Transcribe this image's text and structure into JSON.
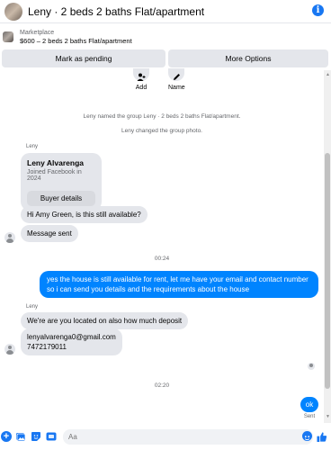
{
  "header": {
    "title": "Leny · 2 beds 2 baths Flat/apartment",
    "info_glyph": "i"
  },
  "marketplace": {
    "label": "Marketplace",
    "listing": "$600 – 2 beds 2 baths Flat/apartment"
  },
  "actions": {
    "mark_pending": "Mark as pending",
    "more_options": "More Options"
  },
  "quick_actions": [
    {
      "label": "Add",
      "icon": "add-person-icon"
    },
    {
      "label": "Name",
      "icon": "pencil-icon"
    }
  ],
  "system_messages": [
    "Leny named the group Leny · 2 beds 2 baths Flat/apartment.",
    "Leny changed the group photo."
  ],
  "sender_name": "Leny",
  "profile_card": {
    "name": "Leny Alvarenga",
    "joined": "Joined Facebook in 2024",
    "button": "Buyer details"
  },
  "messages": {
    "m1": "Hi Amy Green, is this still available?",
    "m2": "Message sent",
    "time1": "00:24",
    "m3": "yes the house is still available for rent, let me have your email  and contact number so i can send you details and the requirements about the house",
    "sender2": "Leny",
    "m4": "We're are you located on also how much deposit",
    "m5_line1": "lenyalvarenga0@gmail.com",
    "m5_line2": "7472179011",
    "time2": "02:20",
    "m6": "ok",
    "status": "Sent"
  },
  "composer": {
    "placeholder": "Aa"
  },
  "colors": {
    "accent": "#1877f2",
    "outgoing_bubble": "#0084ff",
    "incoming_bubble": "#e4e6eb"
  }
}
